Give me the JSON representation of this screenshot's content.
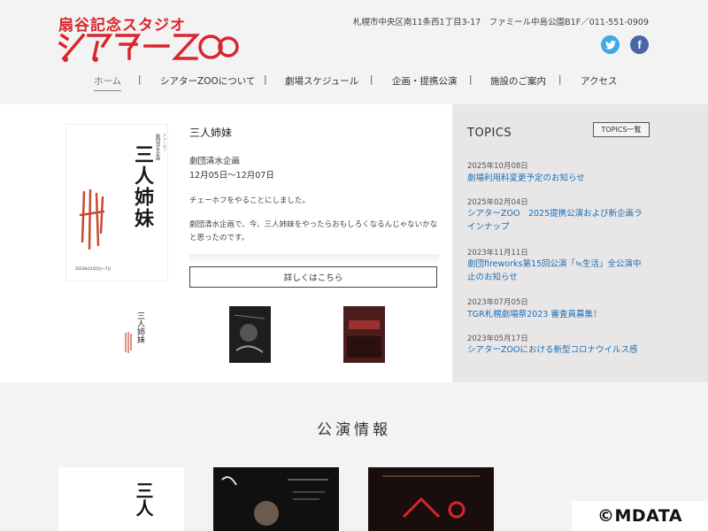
{
  "header": {
    "logo_sub": "扇谷記念スタジオ",
    "logo_main": "シアターZOO",
    "address": "札幌市中央区南11条西1丁目3-17　ファミール中島公園B1F／011-551-0909",
    "social": {
      "twitter_icon": "twitter-icon",
      "facebook_icon": "facebook-icon",
      "twitter_glyph": "🐦",
      "facebook_glyph": "f"
    }
  },
  "nav": {
    "items": [
      {
        "label": "ホーム",
        "active": true
      },
      {
        "label": "シアターZOOについて"
      },
      {
        "label": "劇場スケジュール"
      },
      {
        "label": "企画・提携公演"
      },
      {
        "label": "施設のご案内"
      },
      {
        "label": "アクセス"
      }
    ],
    "separator": "|"
  },
  "feature": {
    "poster_title": "三人姉妹",
    "poster_small1": "劇団清水企画",
    "poster_small2": "チェーホフ",
    "poster_dates": "2023年12月5日〜7日",
    "title": "三人姉妹",
    "company": "劇団清水企画",
    "dates": "12月05日～12月07日",
    "p1": "チェーホフをやることにしました。",
    "p2": "劇団清水企画で、今、三人姉妹をやったらおもしろくなるんじゃないかなと思ったのです。",
    "more_label": "詳しくはこちら",
    "thumb1_text": "三人姉妹"
  },
  "topics": {
    "title": "TOPICS",
    "list_button": "TOPICS一覧",
    "items": [
      {
        "date": "2025年10月08日",
        "text": "劇場利用料変更予定のお知らせ"
      },
      {
        "date": "2025年02月04日",
        "text": "シアターZOO　2025提携公演および新企画ラインナップ"
      },
      {
        "date": "2023年11月11日",
        "text": "劇団fireworks第15回公演「≒生活」全公演中止のお知らせ"
      },
      {
        "date": "2023年07月05日",
        "text": "TGR札幌劇場祭2023 審査員募集！"
      },
      {
        "date": "2023年05月17日",
        "text": "シアターZOOにおける新型コロナウイルス感"
      }
    ]
  },
  "performance": {
    "title": "公演情報",
    "card1_text": "三人"
  },
  "watermark": "©MDATA",
  "colors": {
    "brand_red": "#d9252c",
    "link_blue": "#1a6fb5",
    "twitter": "#3ea9e6",
    "facebook": "#4966a8"
  }
}
